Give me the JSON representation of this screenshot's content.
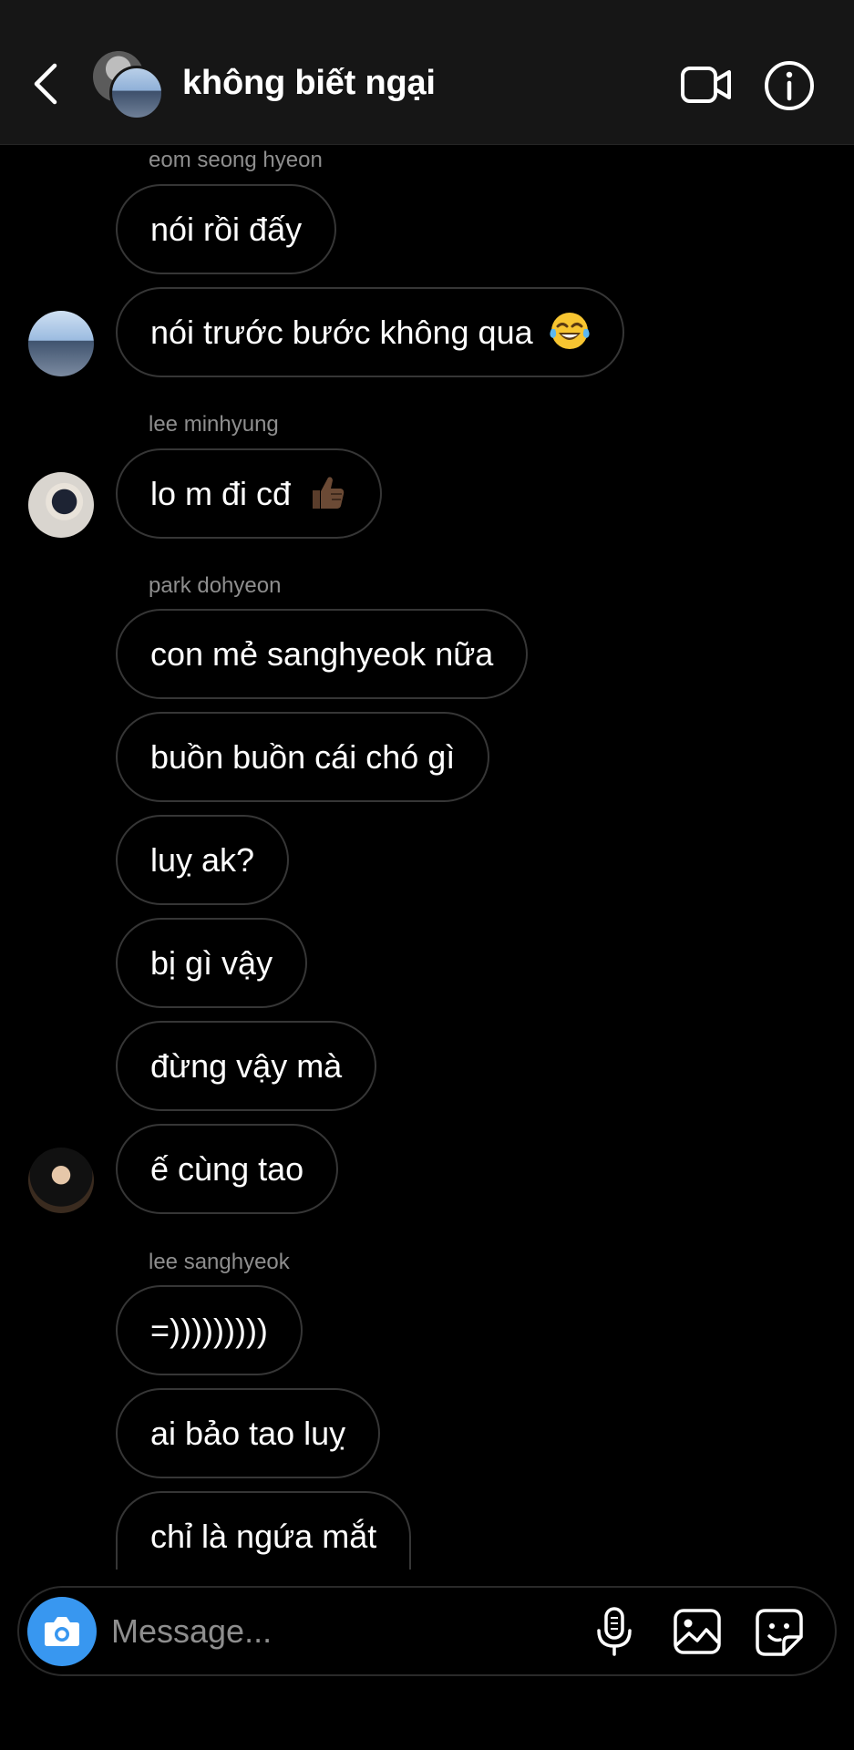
{
  "header": {
    "title": "không biết ngại"
  },
  "messages": [
    {
      "sender": "eom seong hyeon",
      "bubbles": [
        "nói rồi đấy",
        "nói trước bước không qua"
      ]
    },
    {
      "sender": "lee minhyung",
      "bubbles": [
        "lo m đi cđ"
      ]
    },
    {
      "sender": "park dohyeon",
      "bubbles": [
        "con mẻ sanghyeok nữa",
        "buồn buồn cái chó gì",
        "luỵ ak?",
        "bị gì vậy",
        "đừng vậy mà",
        "ế cùng tao"
      ]
    },
    {
      "sender": "lee sanghyeok",
      "bubbles": [
        "=)))))))))",
        "ai bảo tao luỵ",
        "chỉ là ngứa mắt"
      ]
    }
  ],
  "composer": {
    "placeholder": "Message..."
  },
  "icons": {
    "back": "chevron-left-icon",
    "video": "video-camera-icon",
    "info": "info-icon",
    "camera": "camera-icon",
    "mic": "microphone-icon",
    "gallery": "image-icon",
    "sticker": "sticker-icon",
    "emoji_laugh": "tears-of-joy-emoji",
    "emoji_thumbs": "thumbs-up-emoji"
  },
  "colors": {
    "background": "#000000",
    "header": "#161616",
    "bubble_border": "#363636",
    "sender_text": "#8e8e8e",
    "camera_accent": "#3897f0"
  }
}
